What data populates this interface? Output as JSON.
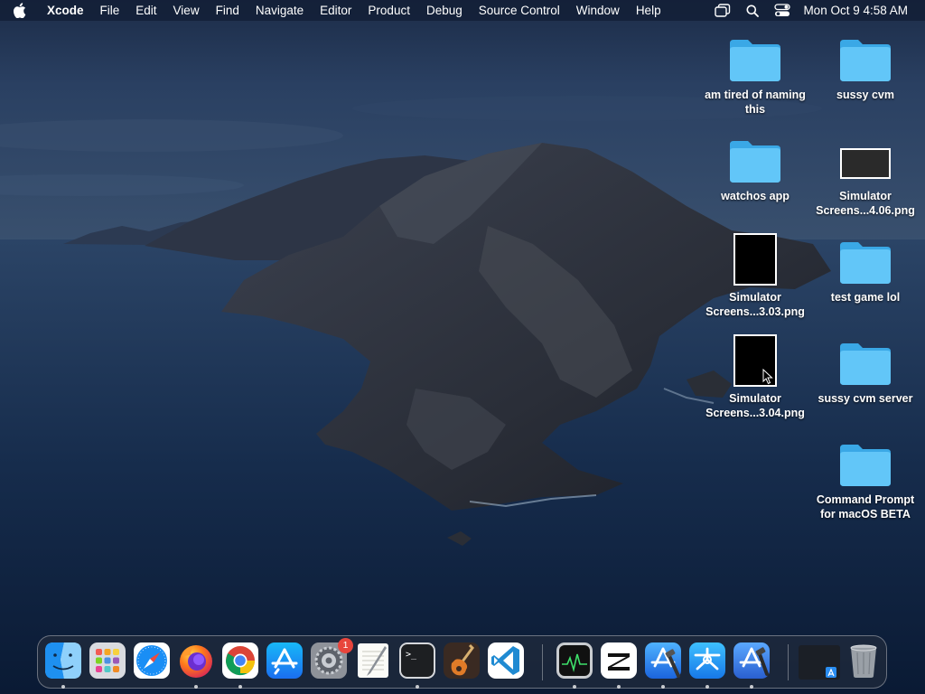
{
  "menubar": {
    "app_name": "Xcode",
    "items": [
      "File",
      "Edit",
      "View",
      "Find",
      "Navigate",
      "Editor",
      "Product",
      "Debug",
      "Source Control",
      "Window",
      "Help"
    ],
    "status_icons": [
      "window-switcher-icon",
      "search-icon",
      "control-center-icon"
    ],
    "clock": "Mon Oct 9  4:58 AM"
  },
  "desktop": {
    "icons": [
      {
        "label": "am tired of naming this",
        "kind": "folder"
      },
      {
        "label": "sussy cvm",
        "kind": "folder"
      },
      {
        "label": "watchos app",
        "kind": "folder"
      },
      {
        "label": "Simulator Screens...4.06.png",
        "kind": "screenshot"
      },
      {
        "label": "Simulator Screens...3.03.png",
        "kind": "screenshot"
      },
      {
        "label": "test game lol",
        "kind": "folder"
      },
      {
        "label": "Simulator Screens...3.04.png",
        "kind": "screenshot"
      },
      {
        "label": "sussy cvm server",
        "kind": "folder"
      },
      {
        "label": "Command Prompt for macOS BETA",
        "kind": "folder"
      }
    ]
  },
  "dock": {
    "apps": [
      {
        "name": "Finder",
        "icon": "finder-icon",
        "running": true
      },
      {
        "name": "Launchpad",
        "icon": "launchpad-icon",
        "running": false
      },
      {
        "name": "Safari",
        "icon": "safari-icon",
        "running": false
      },
      {
        "name": "Firefox",
        "icon": "firefox-icon",
        "running": true
      },
      {
        "name": "Google Chrome",
        "icon": "chrome-icon",
        "running": true
      },
      {
        "name": "App Store",
        "icon": "app-store-icon",
        "running": false
      },
      {
        "name": "System Settings",
        "icon": "system-settings-icon",
        "running": false,
        "badge": "1"
      },
      {
        "name": "TextEdit",
        "icon": "textedit-icon",
        "running": false
      },
      {
        "name": "Terminal",
        "icon": "terminal-icon",
        "running": true
      },
      {
        "name": "GarageBand",
        "icon": "garageband-icon",
        "running": false
      },
      {
        "name": "Visual Studio Code",
        "icon": "vscode-icon",
        "running": false
      },
      {
        "name": "Activity Monitor",
        "icon": "activity-monitor-icon",
        "running": true
      },
      {
        "name": "CapCut",
        "icon": "capcut-icon",
        "running": true
      },
      {
        "name": "Xcode",
        "icon": "xcode-icon",
        "running": true
      },
      {
        "name": "Simulator",
        "icon": "simulator-icon",
        "running": true
      },
      {
        "name": "Xcode Beta",
        "icon": "xcode-beta-icon",
        "running": true
      },
      {
        "name": "Downloads",
        "icon": "downloads-stack-icon",
        "running": false
      },
      {
        "name": "Trash",
        "icon": "trash-icon",
        "running": false
      }
    ]
  },
  "colors": {
    "folder": "#5ac8fa",
    "menubar_bg": "#121e34",
    "badge": "#e8453c"
  }
}
